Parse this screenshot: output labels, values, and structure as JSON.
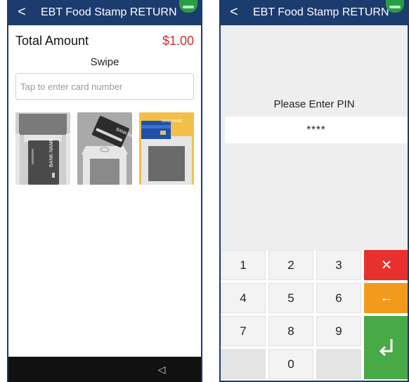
{
  "left_screen": {
    "appbar": {
      "back_glyph": "<",
      "title": "EBT Food Stamp RETURN"
    },
    "total": {
      "label": "Total Amount",
      "amount": "$1.00"
    },
    "entry_mode": "Swipe",
    "card_input": {
      "placeholder": "Tap to enter card number",
      "value": ""
    },
    "readers": [
      {
        "name": "swipe-reader",
        "card_text": "BANK NAME"
      },
      {
        "name": "tap-reader",
        "card_text": "BANK NAME"
      },
      {
        "name": "insert-reader",
        "card_text": "BANK NAME"
      }
    ],
    "nav": {
      "back_glyph": "◁"
    }
  },
  "right_screen": {
    "appbar": {
      "back_glyph": "<",
      "title": "EBT Food Stamp RETURN"
    },
    "pin_prompt": "Please Enter PIN",
    "pin_mask": "****",
    "keypad": {
      "digits": [
        "1",
        "2",
        "3",
        "4",
        "5",
        "6",
        "7",
        "8",
        "9",
        "0"
      ],
      "cancel_glyph": "✕",
      "backspace_glyph": "←"
    }
  },
  "colors": {
    "appbar": "#1c3b6e",
    "amount": "#d32f2f",
    "cancel": "#e8302f",
    "backspace": "#f39a1c",
    "enter": "#48a947",
    "status_indicator": "#2a9d44"
  },
  "icons": {
    "back": "back-arrow-icon",
    "status": "status-indicator-icon",
    "nav_back": "triangle-back-icon",
    "enter": "enter-return-icon"
  }
}
